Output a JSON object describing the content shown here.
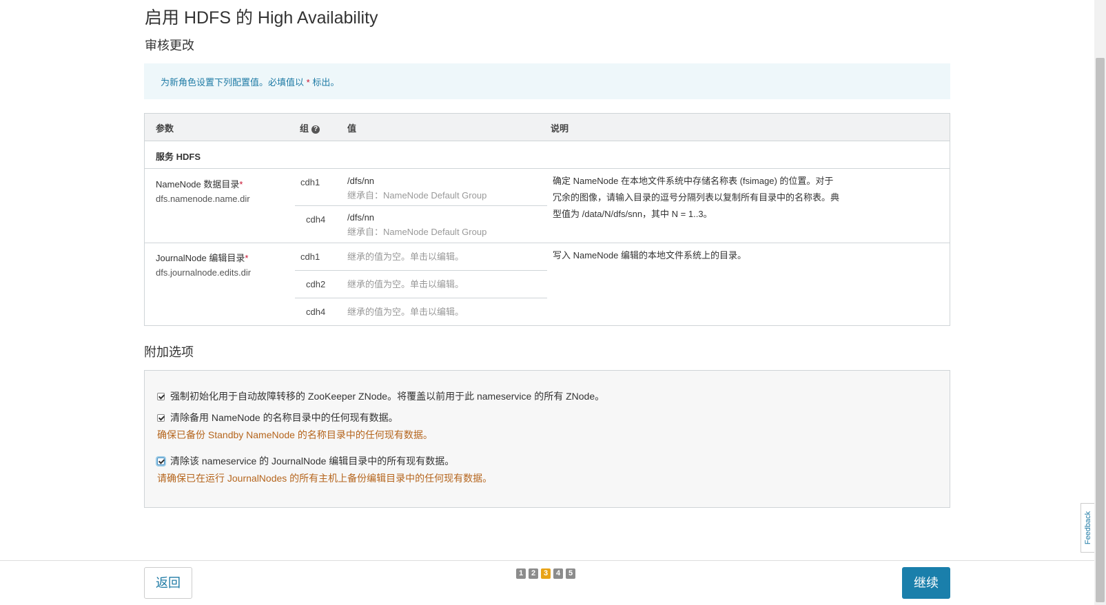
{
  "page": {
    "title": "启用 HDFS 的 High Availability",
    "subtitle": "审核更改"
  },
  "info": {
    "text": "为新角色设置下列配置值。必填值以",
    "star": "*",
    "suffix": "标出。"
  },
  "table": {
    "headers": {
      "param": "参数",
      "group": "组",
      "value": "值",
      "desc": "说明"
    },
    "group_help_icon": "question-circle-icon",
    "service_label": "服务 HDFS",
    "rows": [
      {
        "name": "NameNode 数据目录",
        "required_mark": "*",
        "key": "dfs.namenode.name.dir",
        "description": "确定 NameNode 在本地文件系统中存储名称表 (fsimage) 的位置。对于冗余的图像，请输入目录的逗号分隔列表以复制所有目录中的名称表。典型值为 /data/N/dfs/snn，其中 N = 1..3。",
        "hosts": [
          {
            "host": "cdh1",
            "value": "/dfs/nn",
            "inherit": "继承自：NameNode Default Group"
          },
          {
            "host": "cdh4",
            "value": "/dfs/nn",
            "inherit": "继承自：NameNode Default Group"
          }
        ]
      },
      {
        "name": "JournalNode 编辑目录",
        "required_mark": "*",
        "key": "dfs.journalnode.edits.dir",
        "description": "写入 NameNode 编辑的本地文件系统上的目录。",
        "hosts": [
          {
            "host": "cdh1",
            "inherit": "继承的值为空。单击以编辑。"
          },
          {
            "host": "cdh2",
            "inherit": "继承的值为空。单击以编辑。"
          },
          {
            "host": "cdh4",
            "inherit": "继承的值为空。单击以编辑。"
          }
        ]
      }
    ]
  },
  "extra": {
    "title": "附加选项",
    "options": [
      {
        "label": "强制初始化用于自动故障转移的 ZooKeeper ZNode。将覆盖以前用于此 nameservice 的所有 ZNode。",
        "checked": true
      },
      {
        "label": "清除备用 NameNode 的名称目录中的任何现有数据。",
        "checked": true,
        "warning": "确保已备份 Standby NameNode 的名称目录中的任何现有数据。"
      },
      {
        "label": "清除该 nameservice 的 JournalNode 编辑目录中的所有现有数据。",
        "checked": true,
        "warning": "请确保已在运行 JournalNodes 的所有主机上备份编辑目录中的任何现有数据。"
      }
    ]
  },
  "footer": {
    "back_label": "返回",
    "continue_label": "继续",
    "steps": [
      "1",
      "2",
      "3",
      "4",
      "5"
    ],
    "active_step": "3"
  },
  "feedback_label": "Feedback",
  "colors": {
    "accent": "#1a7fab",
    "active_step": "#e8a317",
    "required": "#c8102e",
    "warning": "#b5651d"
  }
}
